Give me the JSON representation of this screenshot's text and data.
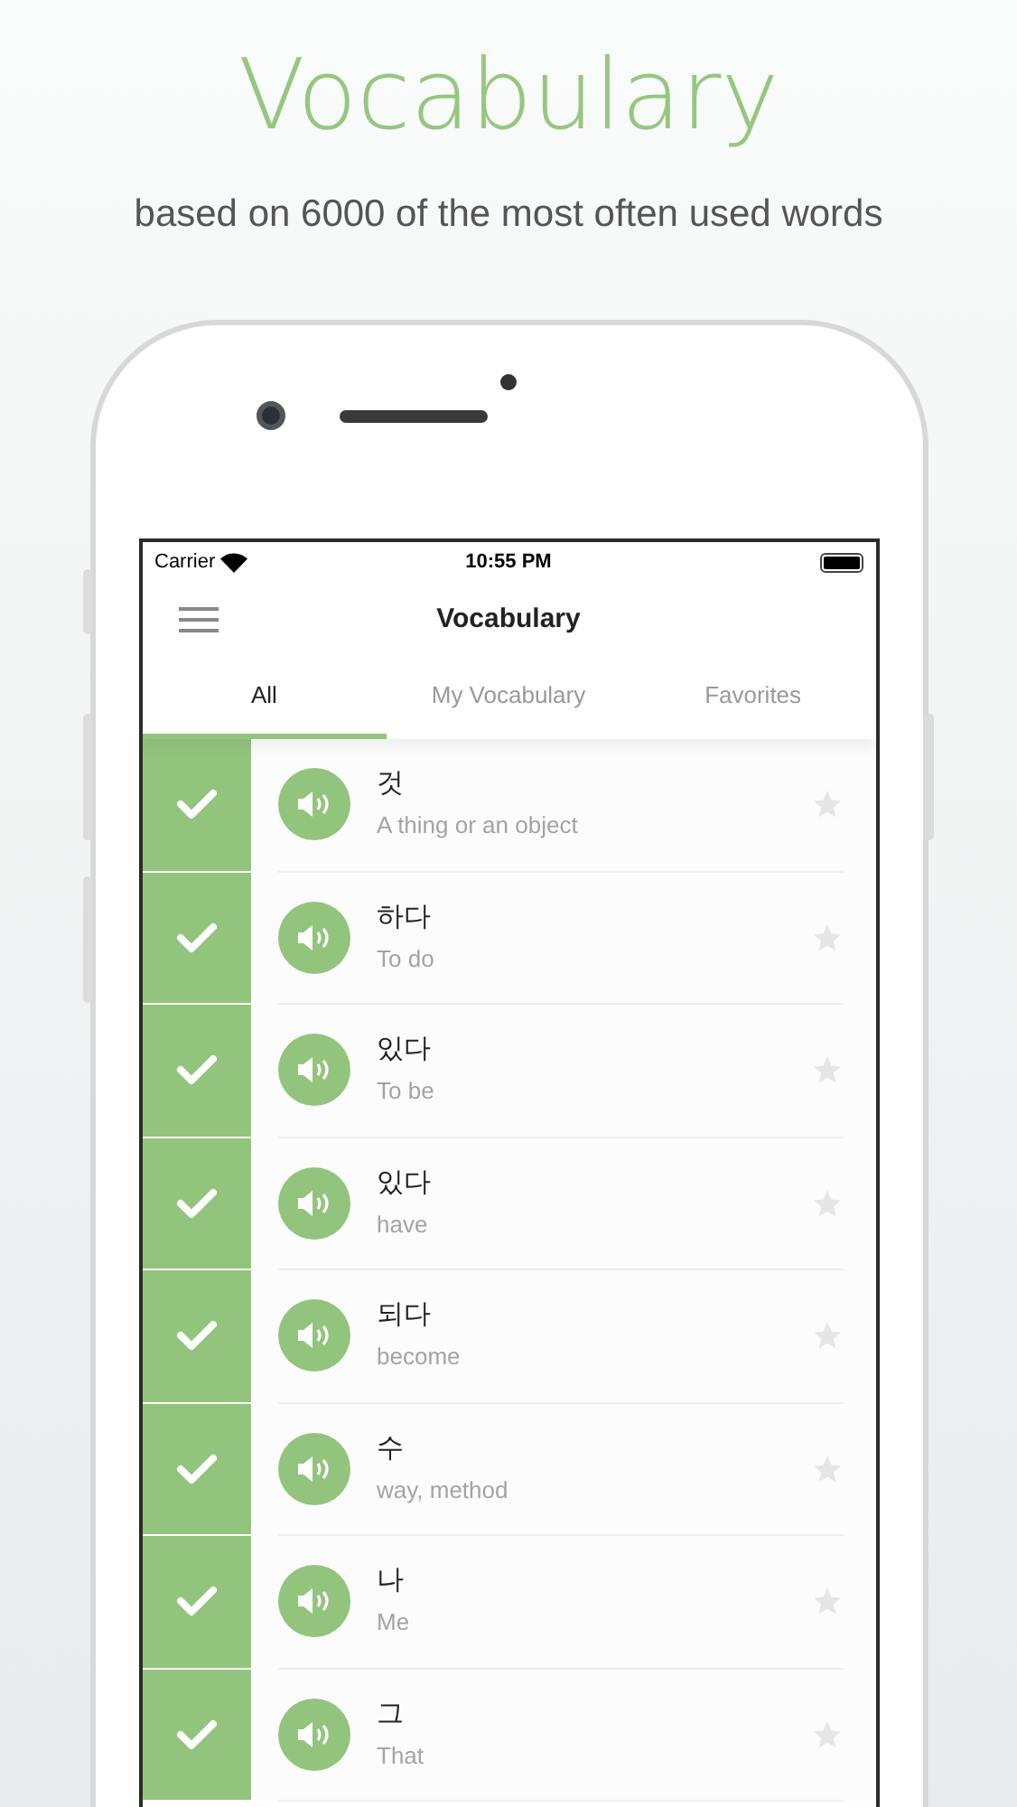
{
  "headline": "Vocabulary",
  "subtitle": "based on 6000 of the most often used words",
  "status_bar": {
    "carrier": "Carrier",
    "time": "10:55 PM"
  },
  "nav": {
    "title": "Vocabulary"
  },
  "tabs": [
    {
      "label": "All",
      "selected": true
    },
    {
      "label": "My Vocabulary",
      "selected": false
    },
    {
      "label": "Favorites",
      "selected": false
    }
  ],
  "words": [
    {
      "word": "것",
      "meaning": "A thing or an object",
      "learned": true,
      "favorite": false
    },
    {
      "word": "하다",
      "meaning": "To do",
      "learned": true,
      "favorite": false
    },
    {
      "word": "있다",
      "meaning": "To be",
      "learned": true,
      "favorite": false
    },
    {
      "word": "있다",
      "meaning": "have",
      "learned": true,
      "favorite": false
    },
    {
      "word": "되다",
      "meaning": "become",
      "learned": true,
      "favorite": false
    },
    {
      "word": "수",
      "meaning": "way, method",
      "learned": true,
      "favorite": false
    },
    {
      "word": "나",
      "meaning": "Me",
      "learned": true,
      "favorite": false
    },
    {
      "word": "그",
      "meaning": "That",
      "learned": true,
      "favorite": false
    }
  ]
}
